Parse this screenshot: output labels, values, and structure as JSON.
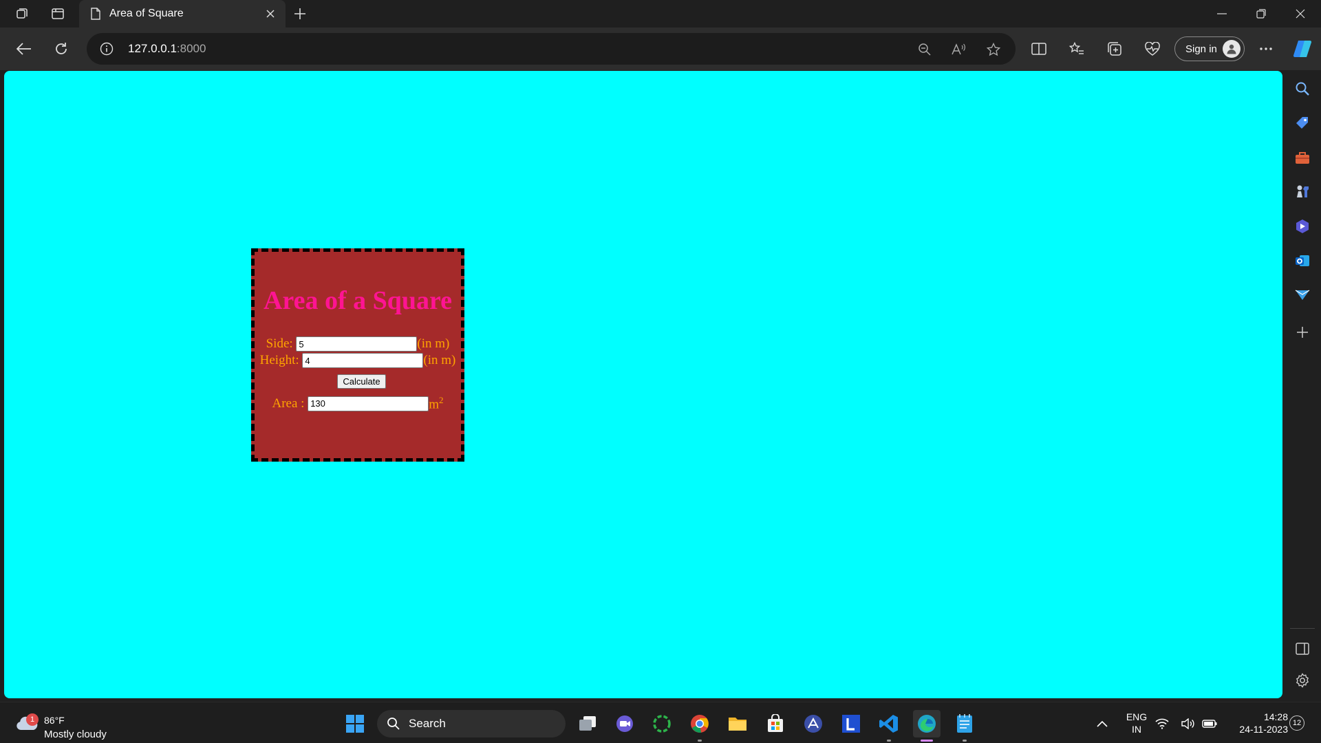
{
  "browser": {
    "tab_title": "Area of Square",
    "url_host": "127.0.0.1",
    "url_port": ":8000",
    "signin_label": "Sign in"
  },
  "page": {
    "background_color": "#00ffff",
    "heading": "Area of a Square",
    "side_label": "Side:",
    "side_value": "5",
    "side_unit": "(in m)",
    "height_label": "Height:",
    "height_value": "4",
    "height_unit": "(in m)",
    "calculate_label": "Calculate",
    "area_label": "Area :",
    "area_value": "130",
    "area_unit": "m",
    "area_unit_exponent": "2"
  },
  "colors": {
    "box_bg": "#a52a2a",
    "heading": "#ff1493",
    "labels": "#ffa500"
  },
  "taskbar": {
    "weather_temp": "86°F",
    "weather_condition": "Mostly cloudy",
    "weather_badge": "1",
    "search_label": "Search",
    "language_line1": "ENG",
    "language_line2": "IN",
    "time": "14:28",
    "date": "24-11-2023",
    "notification_count": "12"
  },
  "icons": {
    "sidebar": [
      "search-icon",
      "tag-icon",
      "toolbox-icon",
      "chess-icon",
      "copilot-icon",
      "outlook-icon",
      "send-icon",
      "add-icon",
      "sidebar-toggle-icon",
      "settings-icon"
    ],
    "taskbar": [
      "windows-start-icon",
      "task-view-icon",
      "meet-icon",
      "refresh-app-icon",
      "chrome-icon",
      "file-explorer-icon",
      "store-icon",
      "vpn-icon",
      "l-app-icon",
      "vscode-icon",
      "edge-icon",
      "notepad-icon"
    ]
  }
}
